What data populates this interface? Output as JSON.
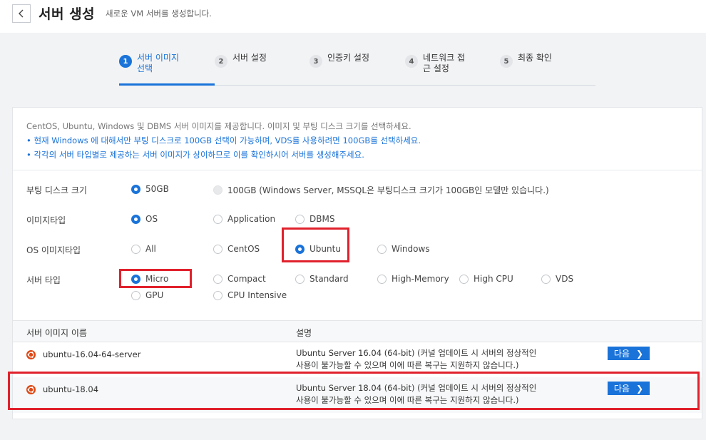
{
  "header": {
    "title": "서버 생성",
    "subtitle": "새로운 VM 서버를 생성합니다."
  },
  "steps": [
    {
      "num": "1",
      "label": "서버 이미지\n선택"
    },
    {
      "num": "2",
      "label": "서버 설정"
    },
    {
      "num": "3",
      "label": "인증키 설정"
    },
    {
      "num": "4",
      "label": "네트워크 접\n근 설정"
    },
    {
      "num": "5",
      "label": "최종 확인"
    }
  ],
  "info": {
    "intro": "CentOS, Ubuntu, Windows 및 DBMS 서버 이미지를 제공합니다. 이미지 및 부팅 디스크 크기를 선택하세요.",
    "bullet1": "• 현재 Windows 에 대해서만 부팅 디스크로 100GB 선택이 가능하며, VDS를 사용하려면 100GB를 선택하세요.",
    "bullet2": "• 각각의 서버 타입별로 제공하는 서버 이미지가 상이하므로 이를 확인하시어 서버를 생성해주세요."
  },
  "options": {
    "boot_disk": {
      "label": "부팅 디스크 크기",
      "opt1": "50GB",
      "opt2": "100GB (Windows Server, MSSQL은 부팅디스크 크기가 100GB인 모델만 있습니다.)"
    },
    "image_type": {
      "label": "이미지타입",
      "opt1": "OS",
      "opt2": "Application",
      "opt3": "DBMS"
    },
    "os_image_type": {
      "label": "OS 이미지타입",
      "opt1": "All",
      "opt2": "CentOS",
      "opt3": "Ubuntu",
      "opt4": "Windows"
    },
    "server_type": {
      "label": "서버 타입",
      "opt1": "Micro",
      "opt2": "Compact",
      "opt3": "Standard",
      "opt4": "High-Memory",
      "opt5": "High CPU",
      "opt6": "VDS",
      "opt7": "GPU",
      "opt8": "CPU Intensive"
    }
  },
  "table": {
    "col_name": "서버 이미지 이름",
    "col_desc": "설명",
    "rows": [
      {
        "name": "ubuntu-16.04-64-server",
        "desc1": "Ubuntu Server 16.04 (64-bit) (커널 업데이트 시 서버의 정상적인",
        "desc2": "사용이 불가능할 수 있으며 이에 따른 복구는 지원하지 않습니다.)",
        "button": "다음"
      },
      {
        "name": "ubuntu-18.04",
        "desc1": "Ubuntu Server 18.04 (64-bit) (커널 업데이트 시 서버의 정상적인",
        "desc2": "사용이 불가능할 수 있으며 이에 따른 복구는 지원하지 않습니다.)",
        "button": "다음"
      }
    ]
  },
  "colors": {
    "accent": "#1a73d9",
    "highlight": "#e0212c",
    "ubuntu": "#dd4814"
  }
}
